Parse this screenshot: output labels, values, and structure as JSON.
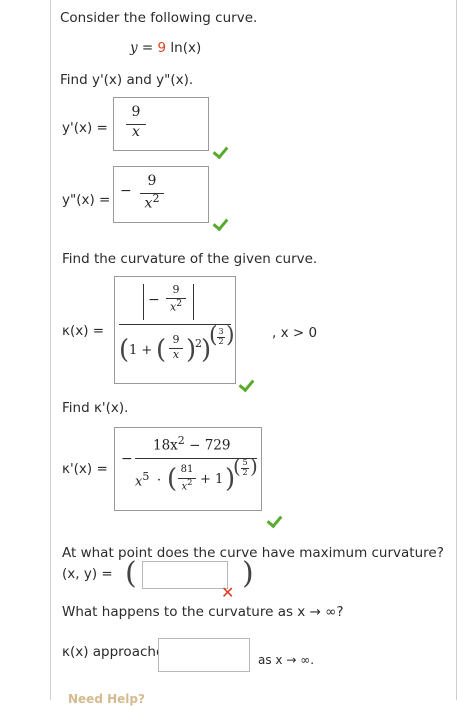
{
  "question": {
    "intro": "Consider the following curve.",
    "curve_lhs": "y = ",
    "curve_coef": "9",
    "curve_fn": " ln(x)",
    "prompt_derivs": "Find y'(x) and y\"(x).",
    "y1_label": "y'(x)  =",
    "y1_num": "9",
    "y1_den": "x",
    "y2_label": "y\"(x)  =",
    "y2_sign": "−",
    "y2_num": "9",
    "y2_den": "x",
    "y2_exp": "2",
    "curvature_prompt": "Find the curvature of the given curve.",
    "kappa_label": "κ(x)  =",
    "kappa_num_sign": "−",
    "kappa_num_num": "9",
    "kappa_num_den": "x",
    "kappa_num_exp": "2",
    "kappa_den_one": "1 +",
    "kappa_den_frac_num": "9",
    "kappa_den_frac_den": "x",
    "kappa_den_sq": "2",
    "kappa_den_pow_num": "3",
    "kappa_den_pow_den": "2",
    "domain_note": ", x > 0",
    "kprime_prompt": "Find κ'(x).",
    "kprime_label": "κ'(x)  =",
    "kprime_sign": "−",
    "kprime_num": "18x",
    "kprime_num_exp": "2",
    "kprime_num_rest": " − 729",
    "kprime_den_x": "x",
    "kprime_den_x_exp": "5",
    "kprime_den_dot": "·",
    "kprime_den_frac_num": "81",
    "kprime_den_frac_den": "x",
    "kprime_den_frac_exp": "2",
    "kprime_den_plus": "+ 1",
    "kprime_pow_num": "5",
    "kprime_pow_den": "2",
    "max_prompt": "At what point does the curve have maximum curvature?",
    "point_label": "(x, y) =",
    "point_value": "",
    "infinity_prompt": "What happens to the curvature as x → ∞?",
    "approach_label": "κ(x) approaches",
    "approach_value": "",
    "approach_suffix": "as x → ∞.",
    "help_text": "Need Help?"
  },
  "colors": {
    "correct": "#5aaa2e",
    "incorrect": "#e03a1b",
    "coef": "#e0421d"
  }
}
